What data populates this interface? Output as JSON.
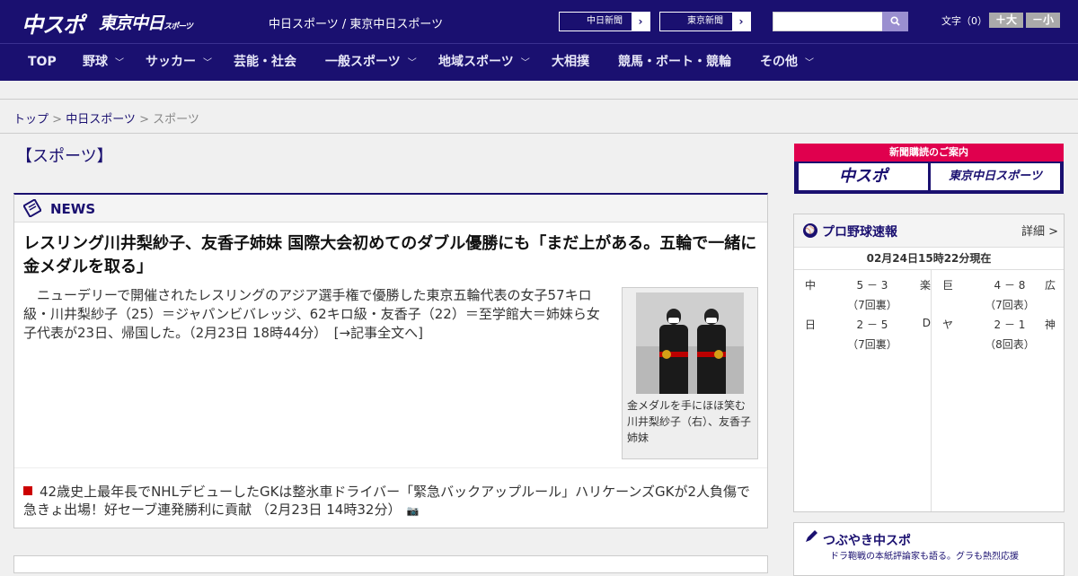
{
  "header": {
    "logo_chuspo": "中スポ",
    "logo_tokyo": "東京中日",
    "logo_tokyo_small": "スポーツ",
    "site_name": "中日スポーツ / 東京中日スポーツ",
    "paper_chunichi": "中日新聞",
    "paper_tokyo": "東京新聞",
    "arrow": "›",
    "search_placeholder": "",
    "font_label": "文字（0）",
    "font_larger": "＋大",
    "font_smaller": "－小"
  },
  "nav": {
    "items": [
      {
        "label": "TOP",
        "chev": ""
      },
      {
        "label": "野球",
        "chev": "﹀"
      },
      {
        "label": "サッカー",
        "chev": "﹀"
      },
      {
        "label": "芸能・社会",
        "chev": ""
      },
      {
        "label": "一般スポーツ",
        "chev": "﹀"
      },
      {
        "label": "地域スポーツ",
        "chev": "﹀"
      },
      {
        "label": "大相撲",
        "chev": ""
      },
      {
        "label": "競馬・ボート・競輪",
        "chev": ""
      },
      {
        "label": "その他",
        "chev": "﹀"
      }
    ]
  },
  "breadcrumb": {
    "top": "トップ",
    "sep": " > ",
    "chunichi": "中日スポーツ",
    "current": "スポーツ"
  },
  "page_title": "【スポーツ】",
  "news": {
    "section_label": "NEWS",
    "headline": "レスリング川井梨紗子、友香子姉妹 国際大会初めてのダブル優勝にも「まだ上がある。五輪で一緒に金メダルを取る」",
    "body": "ニューデリーで開催されたレスリングのアジア選手権で優勝した東京五輪代表の女子57キロ級・川井梨紗子（25）＝ジャパンビバレッジ、62キロ級・友香子（22）＝至学館大＝姉妹ら女子代表が23日、帰国した。（2月23日 18時44分）　[→記事全文へ]",
    "photo_caption": "金メダルを手にほほ笑む川井梨紗子（右）、友香子姉妹",
    "sub_item": "42歳史上最年長でNHLデビューしたGKは整氷車ドライバー「緊急バックアップルール」ハリケーンズGKが2人負傷で急きょ出場！好セーブ連発勝利に貢献 （2月23日 14時32分）",
    "camera_icon": "📷"
  },
  "ad": {
    "title": "新聞購読のご案内",
    "logo_chuspo": "中スポ",
    "logo_tokyo": "東京中日スポーツ"
  },
  "baseball": {
    "title": "プロ野球速報",
    "detail": "詳細 >",
    "ball": "⚾",
    "timestamp": "02月24日15時22分現在",
    "games": [
      {
        "t1": "中",
        "score": "5 － 3",
        "t2": "楽",
        "inning": "（7回裏）"
      },
      {
        "t1": "巨",
        "score": "4 － 8",
        "t2": "広",
        "inning": "（7回表）"
      },
      {
        "t1": "日",
        "score": "2 － 5",
        "t2": "D",
        "inning": "（7回裏）"
      },
      {
        "t1": "ヤ",
        "score": "2 － 1",
        "t2": "神",
        "inning": "（8回表）"
      }
    ]
  },
  "tsubuyaki": {
    "title": "つぶやき中スポ",
    "subtitle": "ドラ鞄戦の本紙評論家も語る。グラも熱烈応援"
  }
}
